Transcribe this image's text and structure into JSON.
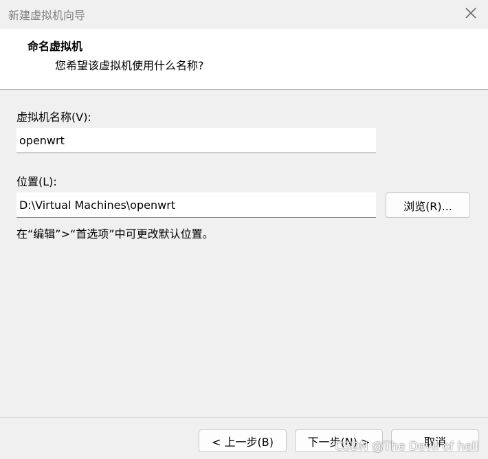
{
  "window": {
    "title": "新建虚拟机向导",
    "close_icon": "close-icon"
  },
  "header": {
    "title": "命名虚拟机",
    "subtitle": "您希望该虚拟机使用什么名称?"
  },
  "form": {
    "name_label": "虚拟机名称(V):",
    "name_value": "openwrt",
    "location_label": "位置(L):",
    "location_value": "D:\\Virtual Machines\\openwrt",
    "browse_label": "浏览(R)...",
    "hint": "在“编辑”>“首选项”中可更改默认位置。"
  },
  "footer": {
    "back_label": "< 上一步(B)",
    "next_label": "下一步(N) >",
    "cancel_label": "取消"
  },
  "watermark": "CSDN @The Devil of hell"
}
